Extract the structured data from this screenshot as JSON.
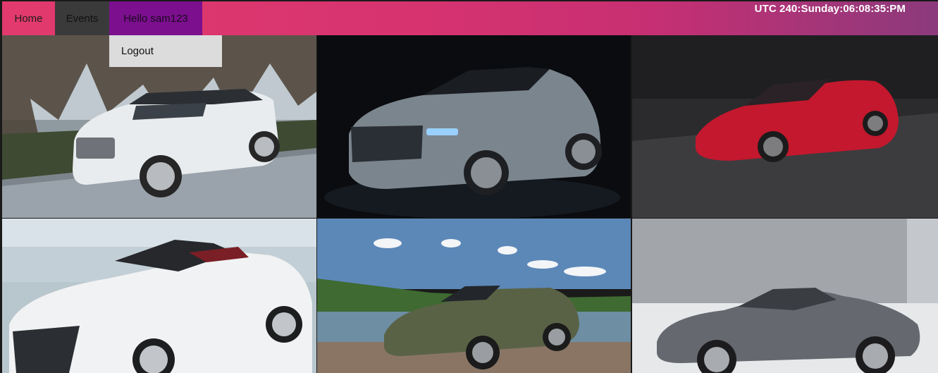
{
  "nav": {
    "home": "Home",
    "events": "Events",
    "hello_prefix": "Hello",
    "username": "sam123"
  },
  "dropdown": {
    "logout": "Logout"
  },
  "clock": {
    "text": "UTC 240:Sunday:06:08:35:PM"
  },
  "gallery": {
    "photos": [
      {
        "subject": "white SUV on road"
      },
      {
        "subject": "grey convertible muscle car"
      },
      {
        "subject": "red sports car"
      },
      {
        "subject": "white convertible"
      },
      {
        "subject": "green convertible by lake"
      },
      {
        "subject": "grey roadster"
      }
    ]
  },
  "colors": {
    "nav_gradient_start": "#e23a6e",
    "nav_gradient_end": "#8b3a7c",
    "events_bg": "#3a3a3a",
    "hello_bg": "#7b0f8e",
    "dropdown_bg": "#dcdcdc"
  }
}
